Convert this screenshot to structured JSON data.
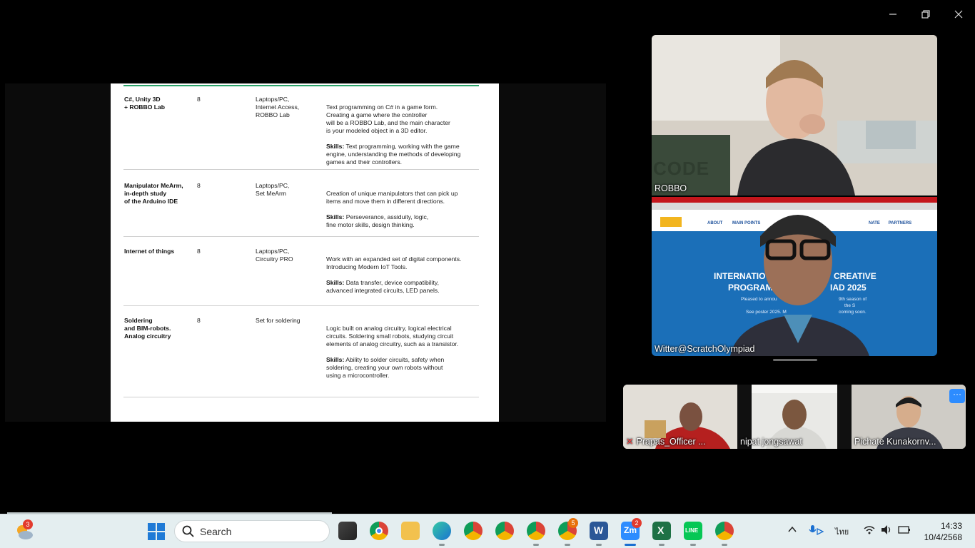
{
  "slide": {
    "rows": [
      {
        "name": "C#, Unity 3D\n+ ROBBO Lab",
        "hours": "8",
        "equipment": "Laptops/PC,\nInternet  Access,\nROBBO Lab",
        "description": "Text programming on C# in a game form.\nCreating a game where the controller\nwill be a ROBBO Lab, and the main character\nis your modeled object in a 3D editor.",
        "skills_label": "Skills:",
        "skills": " Text programming, working with the game\nengine, understanding the methods of developing\ngames and their controllers."
      },
      {
        "name": "Manipulator MeArm,\nin-depth study\nof the Arduino IDE",
        "hours": "8",
        "equipment": "Laptops/PC,\nSet MeArm",
        "description": "Creation of unique manipulators that can pick up\nitems and move them in different directions.",
        "skills_label": "Skills:",
        "skills": " Perseverance, assiduity, logic,\nfine motor skills, design thinking."
      },
      {
        "name": "Internet of things",
        "hours": "8",
        "equipment": "Laptops/PC,\nCircuitry PRO",
        "description": "Work with an expanded set of digital components.\nIntroducing Modern IoT Tools.",
        "skills_label": "Skills:",
        "skills": " Data transfer, device compatibility,\nadvanced integrated circuits, LED panels."
      },
      {
        "name": "Soldering\nand BIM-robots.\nAnalog circuitry",
        "hours": "8",
        "equipment": "Set for soldering",
        "description": "Logic built on analog circuitry, logical electrical\ncircuits. Soldering small robots, studying circuit\nelements of analog circuitry, such as a transistor.",
        "skills_label": "Skills:",
        "skills": " Ability to solder circuits, safety when\nsoldering, creating your own robots without\nusing a microcontroller."
      }
    ]
  },
  "participants": {
    "main": [
      {
        "name": "ROBBO"
      },
      {
        "name": "Witter@ScratchOlympiad"
      }
    ],
    "strip": [
      {
        "name": "Prapas_Officer ..."
      },
      {
        "name": "nipat jongsawat"
      },
      {
        "name": "Pichate Kunakornv..."
      }
    ],
    "witter_screen": {
      "heading_line1": "INTERNATIO",
      "heading_line1b": "CREATIVE",
      "heading_line2": "PROGRAM",
      "heading_line2b": "IAD 2025",
      "nav": [
        "ABOUT",
        "MAIN POINTS",
        "NATE",
        "PARTNERS"
      ],
      "sub1": "Pleased to annou",
      "sub1b": "9th season of",
      "sub2": "the S",
      "sub3": "See poster 2025. M",
      "sub3b": "coming soon."
    },
    "robbo_scene_text": "CODE",
    "more_label": "···"
  },
  "taskbar": {
    "weather_badge": "3",
    "search_placeholder": "Search",
    "zoom_badge": "2",
    "chrome_badge": "5",
    "tray_lang": "ไทย",
    "time": "14:33",
    "date": "10/4/2568"
  },
  "colors": {
    "accent_green": "#2aa36a",
    "zoom_blue": "#2d8cff",
    "taskbar_bg": "#e4eef0"
  }
}
